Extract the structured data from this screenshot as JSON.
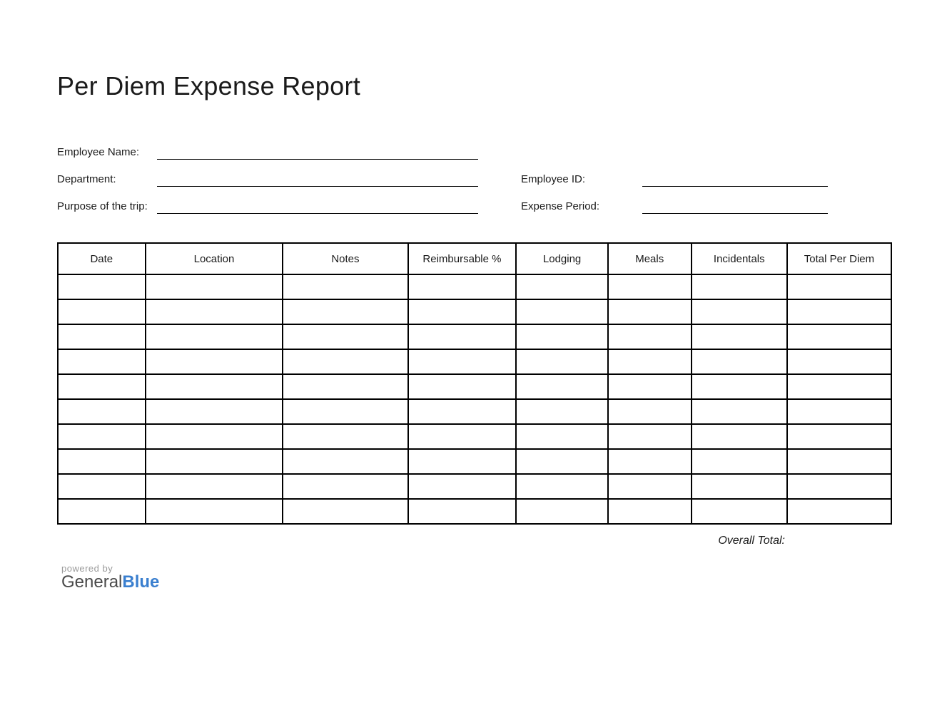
{
  "title": "Per Diem Expense Report",
  "meta": {
    "employee_name_label": "Employee Name:",
    "department_label": "Department:",
    "purpose_label": "Purpose of the trip:",
    "employee_id_label": "Employee ID:",
    "expense_period_label": "Expense Period:"
  },
  "table": {
    "headers": {
      "date": "Date",
      "location": "Location",
      "notes": "Notes",
      "reimbursable": "Reimbursable %",
      "lodging": "Lodging",
      "meals": "Meals",
      "incidentals": "Incidentals",
      "total": "Total Per Diem"
    },
    "row_count": 10
  },
  "overall_total_label": "Overall Total:",
  "footer": {
    "powered_by": "powered by",
    "brand_general": "General",
    "brand_blue": "Blue"
  }
}
